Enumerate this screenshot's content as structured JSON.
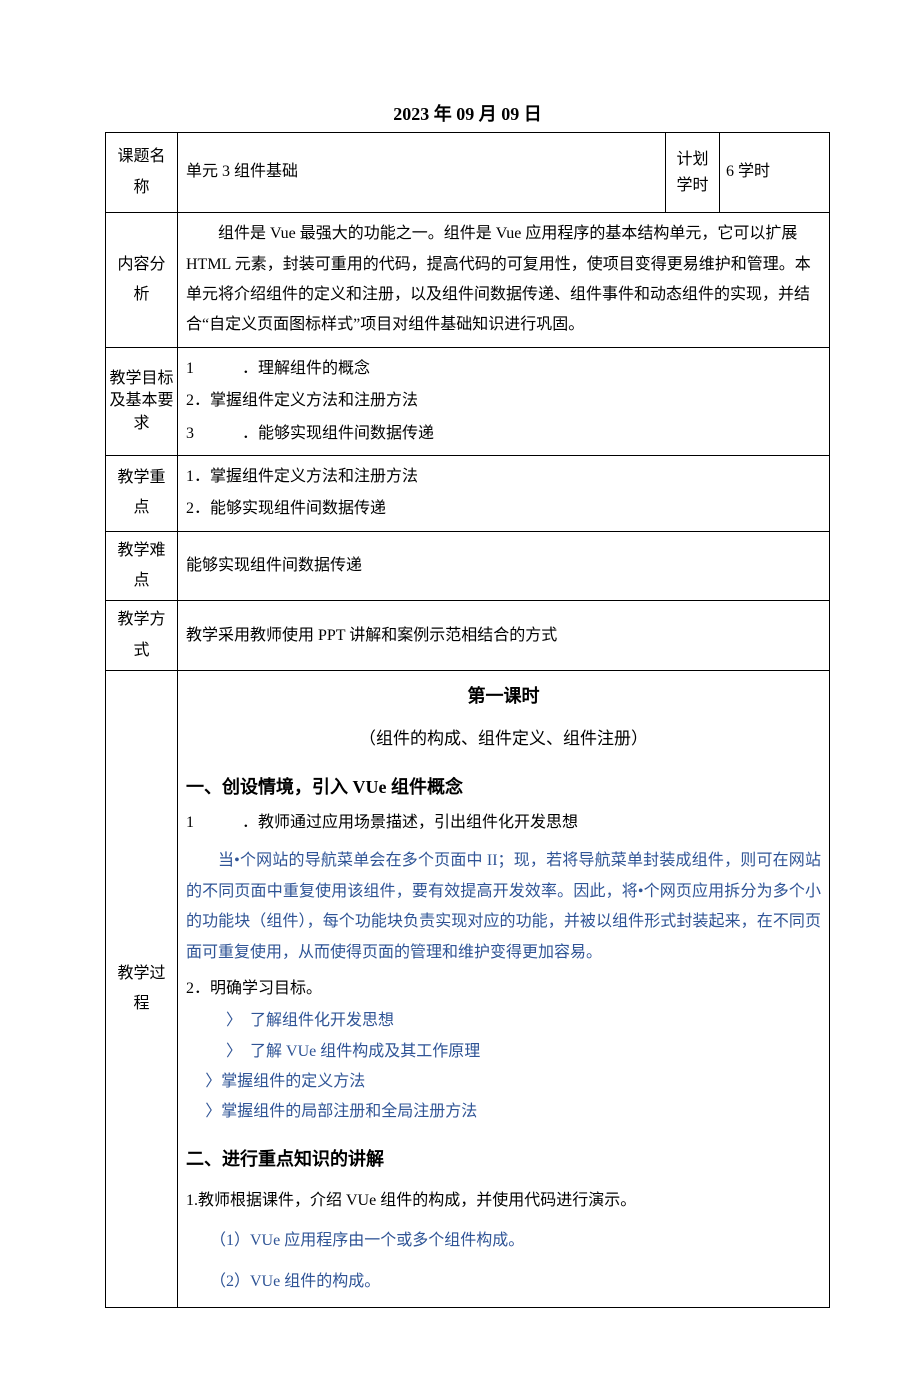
{
  "date": "2023 年 09 月 09 日",
  "rows": {
    "topic": {
      "label": "课题名称",
      "value": "单元 3 组件基础",
      "plan_label": "计划\n学时",
      "plan_value": "6 学时"
    },
    "analysis": {
      "label": "内容分析",
      "text": "组件是 Vue 最强大的功能之一。组件是 Vue 应用程序的基本结构单元，它可以扩展 HTML 元素，封装可重用的代码，提高代码的可复用性，使项目变得更易维护和管理。本单元将介绍组件的定义和注册，以及组件间数据传递、组件事件和动态组件的实现，并结合“自定义页面图标样式”项目对组件基础知识进行巩固。"
    },
    "goals": {
      "label": "教学目标及基本要求",
      "items": [
        "1",
        "．理解组件的概念",
        "2．掌握组件定义方法和注册方法",
        "3",
        "．能够实现组件间数据传递"
      ]
    },
    "focus": {
      "label": "教学重点",
      "items": [
        "1．掌握组件定义方法和注册方法",
        "2．能够实现组件间数据传递"
      ]
    },
    "difficulty": {
      "label": "教学难点",
      "text": "能够实现组件间数据传递"
    },
    "method": {
      "label": "教学方式",
      "text": "教学采用教师使用 PPT 讲解和案例示范相结合的方式"
    },
    "process": {
      "label": "教学过程",
      "title1": "第一课时",
      "subtitle": "（组件的构成、组件定义、组件注册）",
      "sec1": "一、创设情境，引入 VUe 组件概念",
      "p1_num": "1",
      "p1_text": "．教师通过应用场景描述，引出组件化开发思想",
      "blue1": "当•个网站的导航菜单会在多个页面中 II；现，若将导航菜单封装成组件，则可在网站的不同页面中重复使用该组件，要有效提高开发效率。因此，将•个网页应用拆分为多个小的功能块（组件），每个功能块负责实现对应的功能，并被以组件形式封装起来，在不同页面可重复使用，从而使得页面的管理和维护变得更加容易。",
      "p2": "2．明确学习目标。",
      "bullets": [
        "了解组件化开发思想",
        "了解 VUe 组件构成及其工作原理",
        "掌握组件的定义方法",
        "掌握组件的局部注册和全局注册方法"
      ],
      "sec2": "二、进行重点知识的讲解",
      "p3": "1.教师根据课件，介绍 VUe 组件的构成，并使用代码进行演示。",
      "blue2": "（1）VUe 应用程序由一个或多个组件构成。",
      "blue3": "（2）VUe 组件的构成。"
    }
  }
}
